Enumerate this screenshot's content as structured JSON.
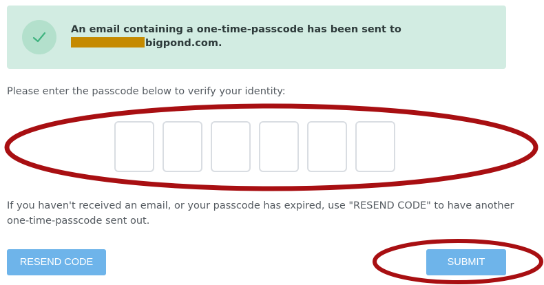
{
  "alert": {
    "icon": "checkmark-icon",
    "line1": "An email containing a one-time-passcode has been sent to",
    "line2": "bigpond.com."
  },
  "instruction": "Please enter the passcode below to verify your identity:",
  "passcode": {
    "boxes": [
      "",
      "",
      "",
      "",
      "",
      ""
    ]
  },
  "help_text": "If you haven't received an email, or your passcode has expired, use \"RESEND CODE\" to have another one-time-passcode sent out.",
  "buttons": {
    "resend_label": "RESEND CODE",
    "submit_label": "SUBMIT"
  },
  "colors": {
    "alert_background": "#d2ece2",
    "alert_icon_background": "#b3e0cc",
    "checkmark": "#3fb37f",
    "button": "#6eb4ea",
    "annotation": "#a80f12",
    "redaction": "#c58a00"
  }
}
